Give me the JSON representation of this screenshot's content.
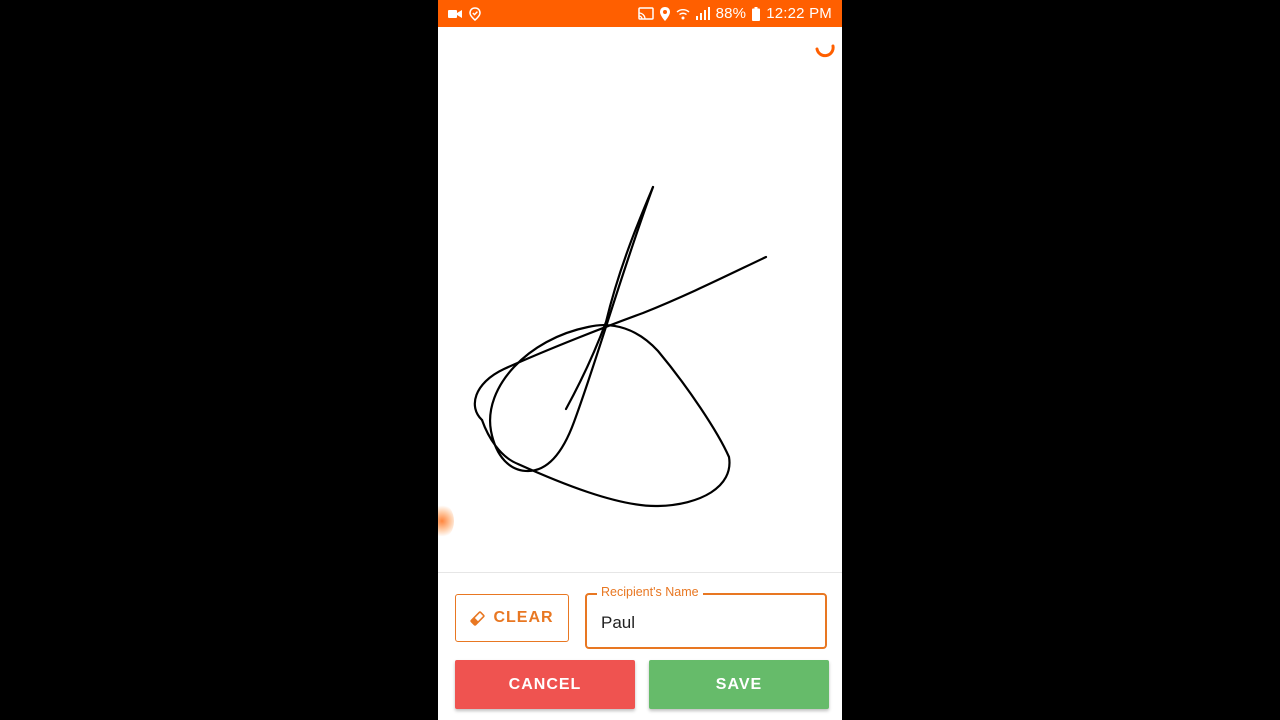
{
  "status_bar": {
    "battery": "88%",
    "time": "12:22 PM",
    "left_icons": [
      "video-camera-icon",
      "location-check-icon"
    ],
    "right_icons": [
      "cast-icon",
      "location-pin-icon",
      "wifi-icon",
      "signal-icon",
      "battery-icon"
    ]
  },
  "actions": {
    "clear_label": "CLEAR",
    "cancel_label": "CANCEL",
    "save_label": "SAVE"
  },
  "recipient": {
    "label": "Recipient's Name",
    "value": "Paul"
  },
  "colors": {
    "status_bar": "#ff5f00",
    "accent": "#e87722",
    "cancel": "#ef5350",
    "save": "#66bb6a"
  }
}
